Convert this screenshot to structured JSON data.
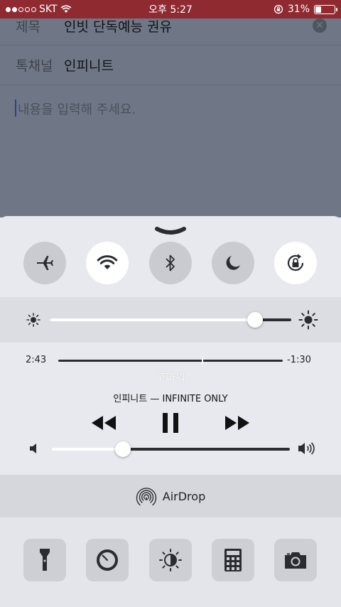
{
  "status_bar": {
    "carrier": "SKT",
    "time": "오후 5:27",
    "battery_percent": "31%",
    "battery_level": 0.31,
    "signal_bars_filled": 2,
    "signal_bars_total": 5
  },
  "compose": {
    "subject_label": "제목",
    "subject_value": "인빗 단독예능 권유",
    "channel_label": "톡채널",
    "channel_value": "인피니트",
    "content_placeholder": "내용을 입력해 주세요."
  },
  "control_center": {
    "toggles": [
      {
        "name": "airplane-mode",
        "on": false
      },
      {
        "name": "wifi",
        "on": true
      },
      {
        "name": "bluetooth",
        "on": false
      },
      {
        "name": "do-not-disturb",
        "on": false
      },
      {
        "name": "rotation-lock",
        "on": true
      }
    ],
    "brightness_level": 0.85,
    "music": {
      "elapsed": "2:43",
      "remaining": "-1:30",
      "progress": 0.64,
      "title": "고마워",
      "artist_album": "인피니트 — INFINITE ONLY",
      "volume_level": 0.3
    },
    "airdrop_label": "AirDrop",
    "shortcuts": [
      "flashlight-icon",
      "timer-icon",
      "night-shift-icon",
      "calculator-icon",
      "camera-icon"
    ]
  }
}
